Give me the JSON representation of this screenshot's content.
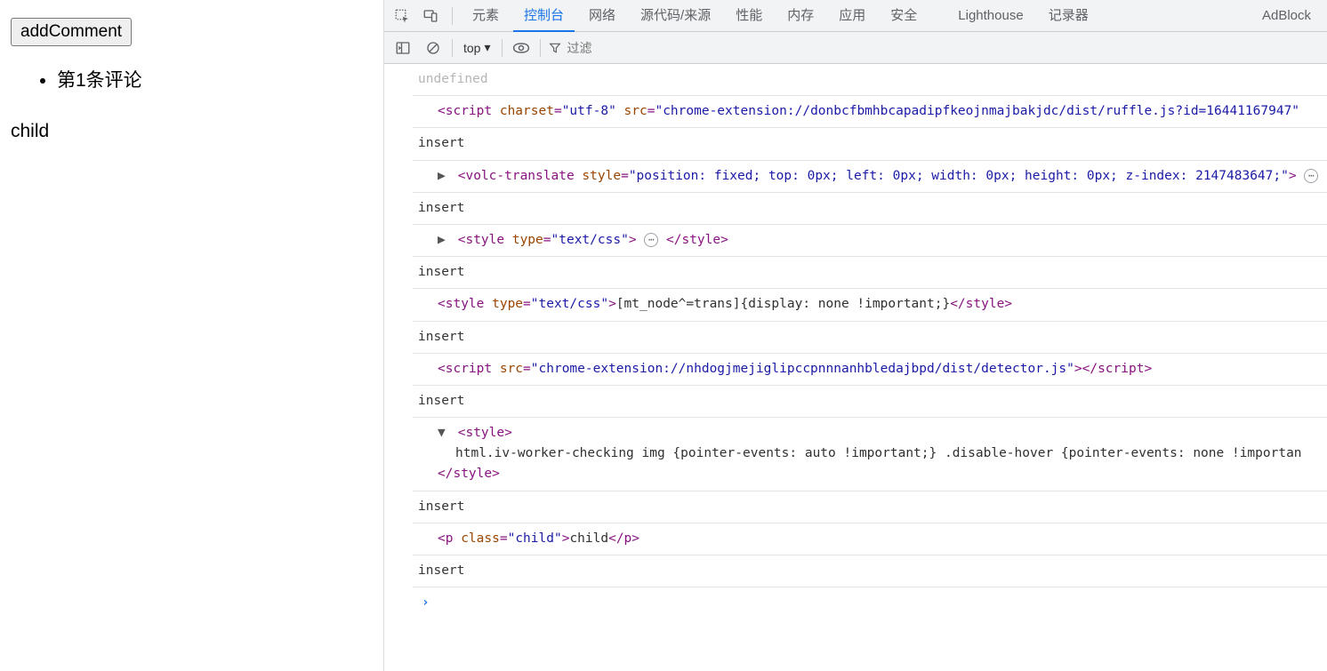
{
  "page": {
    "button_label": "addComment",
    "comments": [
      "第1条评论"
    ],
    "child_text": "child"
  },
  "devtools": {
    "tabs": {
      "elements": "元素",
      "console": "控制台",
      "network": "网络",
      "sources": "源代码/来源",
      "performance": "性能",
      "memory": "内存",
      "application": "应用",
      "security": "安全",
      "lighthouse": "Lighthouse",
      "recorder": "记录器",
      "adblock": "AdBlock"
    },
    "toolbar": {
      "context": "top",
      "filter_placeholder": "过滤"
    },
    "logs": {
      "l0": {
        "text": "undefined"
      },
      "l1": {
        "tag_open": "<script ",
        "attr1_name": "charset",
        "attr1_val": "\"utf-8\"",
        "attr2_name": "src",
        "attr2_val": "\"chrome-extension://donbcfbmhbcapadipfkeojnmajbakjdc/dist/ruffle.js?id=16441167947\"",
        "insert": "insert"
      },
      "l2": {
        "tag_open": "<volc-translate ",
        "attr_name": "style",
        "attr_val": "\"position: fixed; top: 0px; left: 0px; width: 0px; height: 0px; z-index: 2147483647;\"",
        "tag_close": ">",
        "insert": "insert"
      },
      "l3": {
        "tag_open": "<style ",
        "attr_name": "type",
        "attr_val": "\"text/css\"",
        "tag_mid": ">",
        "tag_close": "</style>",
        "insert": "insert"
      },
      "l4": {
        "tag_open": "<style ",
        "attr_name": "type",
        "attr_val": "\"text/css\"",
        "tag_mid": ">",
        "content": "[mt_node^=trans]{display: none !important;}",
        "tag_close": "</style>",
        "insert": "insert"
      },
      "l5": {
        "tag_open": "<script ",
        "attr_name": "src",
        "attr_val": "\"chrome-extension://nhdogjmejiglipccpnnnanhbledajbpd/dist/detector.js\"",
        "tag_mid": ">",
        "tag_close": "</script>",
        "insert": "insert"
      },
      "l6": {
        "tag_open": "<style>",
        "content": "html.iv-worker-checking img {pointer-events: auto !important;} .disable-hover {pointer-events: none !importan",
        "tag_close": "</style>",
        "insert": "insert"
      },
      "l7": {
        "tag_open": "<p ",
        "attr_name": "class",
        "attr_val": "\"child\"",
        "tag_mid": ">",
        "content": "child",
        "tag_close": "</p>",
        "insert": "insert"
      }
    }
  }
}
